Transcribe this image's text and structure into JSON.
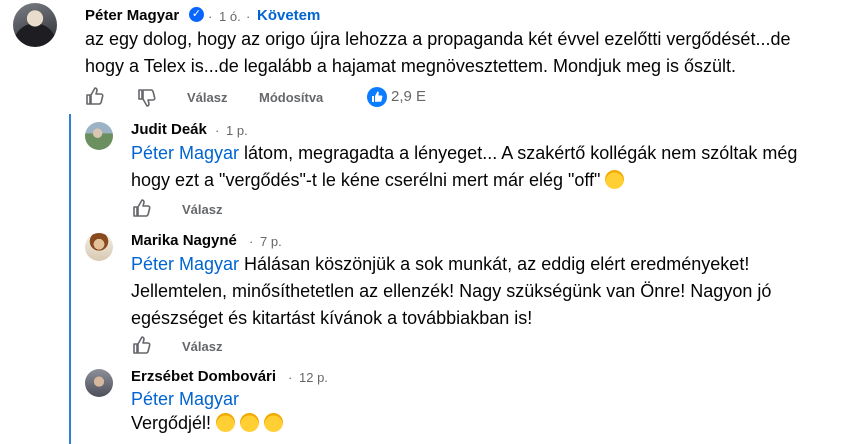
{
  "main_comment": {
    "author": "Péter Magyar",
    "time": "1 ó.",
    "follow_label": "Követem",
    "text": "az egy dolog, hogy az origo újra lehozza a propaganda két évvel ezelőtti vergődését...de hogy a Telex is...de legalább a hajamat megnövesztettem. Mondjuk meg is őszült.",
    "reply_label": "Válasz",
    "edited_label": "Módosítva",
    "reaction_count": "2,9 E"
  },
  "replies": [
    {
      "author": "Judit Deák",
      "time": "1 p.",
      "mention": "Péter Magyar",
      "text": " látom, megragadta a lényeget... A szakértő kollégák nem szóltak még hogy ezt a \"vergődés\"-t le kéne cserélni mert már elég \"off\"",
      "reply_label": "Válasz"
    },
    {
      "author": "Marika Nagyné",
      "time": "7 p.",
      "mention": "Péter Magyar",
      "text": " Hálásan köszönjük a sok munkát, az eddig elért eredményeket! Jellemtelen, minősíthetetlen az ellenzék! Nagy szükségünk van Önre! Nagyon jó egészséget és kitartást kívánok a továbbiakban is!",
      "reply_label": "Válasz"
    },
    {
      "author": "Erzsébet Dombovári",
      "time": "12 p.",
      "mention": "Péter Magyar",
      "text": "Vergődjél!"
    }
  ],
  "icons": {
    "like": "thumbs-up-icon",
    "dislike": "thumbs-down-icon",
    "verified": "verified-badge-icon",
    "reaction": "like-reaction-icon",
    "emoji": "laughing-emoji-icon"
  },
  "colors": {
    "link": "#0064d1",
    "thread_line": "#2d7fd8",
    "reaction_blue": "#0a7cff"
  }
}
